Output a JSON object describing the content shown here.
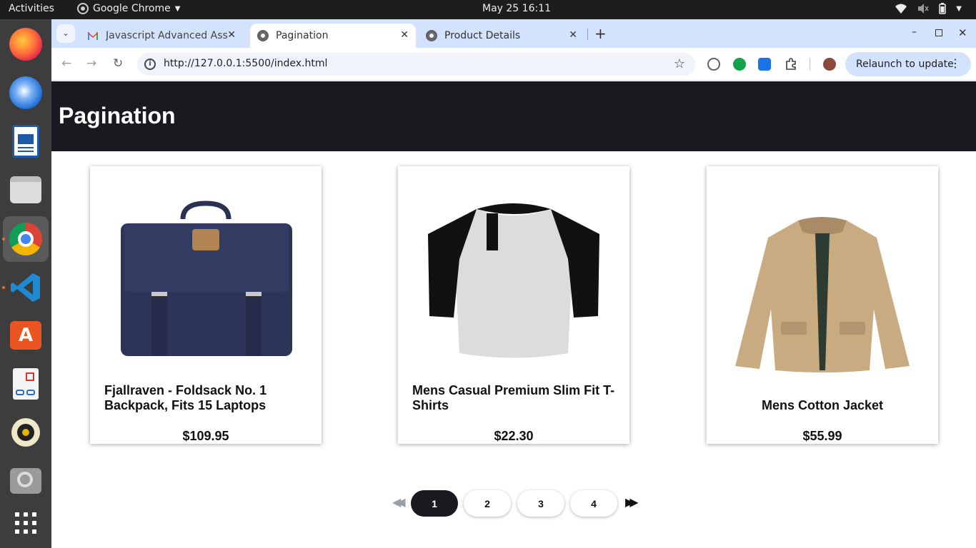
{
  "topbar": {
    "activities": "Activities",
    "app_name": "Google Chrome",
    "clock": "May 25  16:11"
  },
  "dock": {
    "items": [
      "firefox-icon",
      "thunderbird-icon",
      "writer-icon",
      "files-icon",
      "chrome-icon",
      "vscode-icon",
      "app-center-icon",
      "document-viewer-icon",
      "rhythmbox-icon",
      "screenshot-icon",
      "show-apps-icon"
    ]
  },
  "browser": {
    "tabs": [
      {
        "title": "Javascript Advanced Ass",
        "active": false
      },
      {
        "title": "Pagination",
        "active": true
      },
      {
        "title": "Product Details",
        "active": false
      }
    ],
    "url": "http://127.0.0.1:5500/index.html",
    "relaunch_label": "Relaunch to update"
  },
  "page": {
    "title": "Pagination",
    "products": [
      {
        "name": "Fjallraven - Foldsack No. 1 Backpack, Fits 15 Laptops",
        "price": "$109.95"
      },
      {
        "name": "Mens Casual Premium Slim Fit T-Shirts",
        "price": "$22.30"
      },
      {
        "name": "Mens Cotton Jacket",
        "price": "$55.99"
      }
    ],
    "pagination": {
      "pages": [
        "1",
        "2",
        "3",
        "4"
      ],
      "current_page": "1"
    }
  },
  "colors": {
    "header_bg": "#181a20",
    "tabstrip_bg": "#d3e3fd",
    "active_page_bg": "#181a20"
  }
}
